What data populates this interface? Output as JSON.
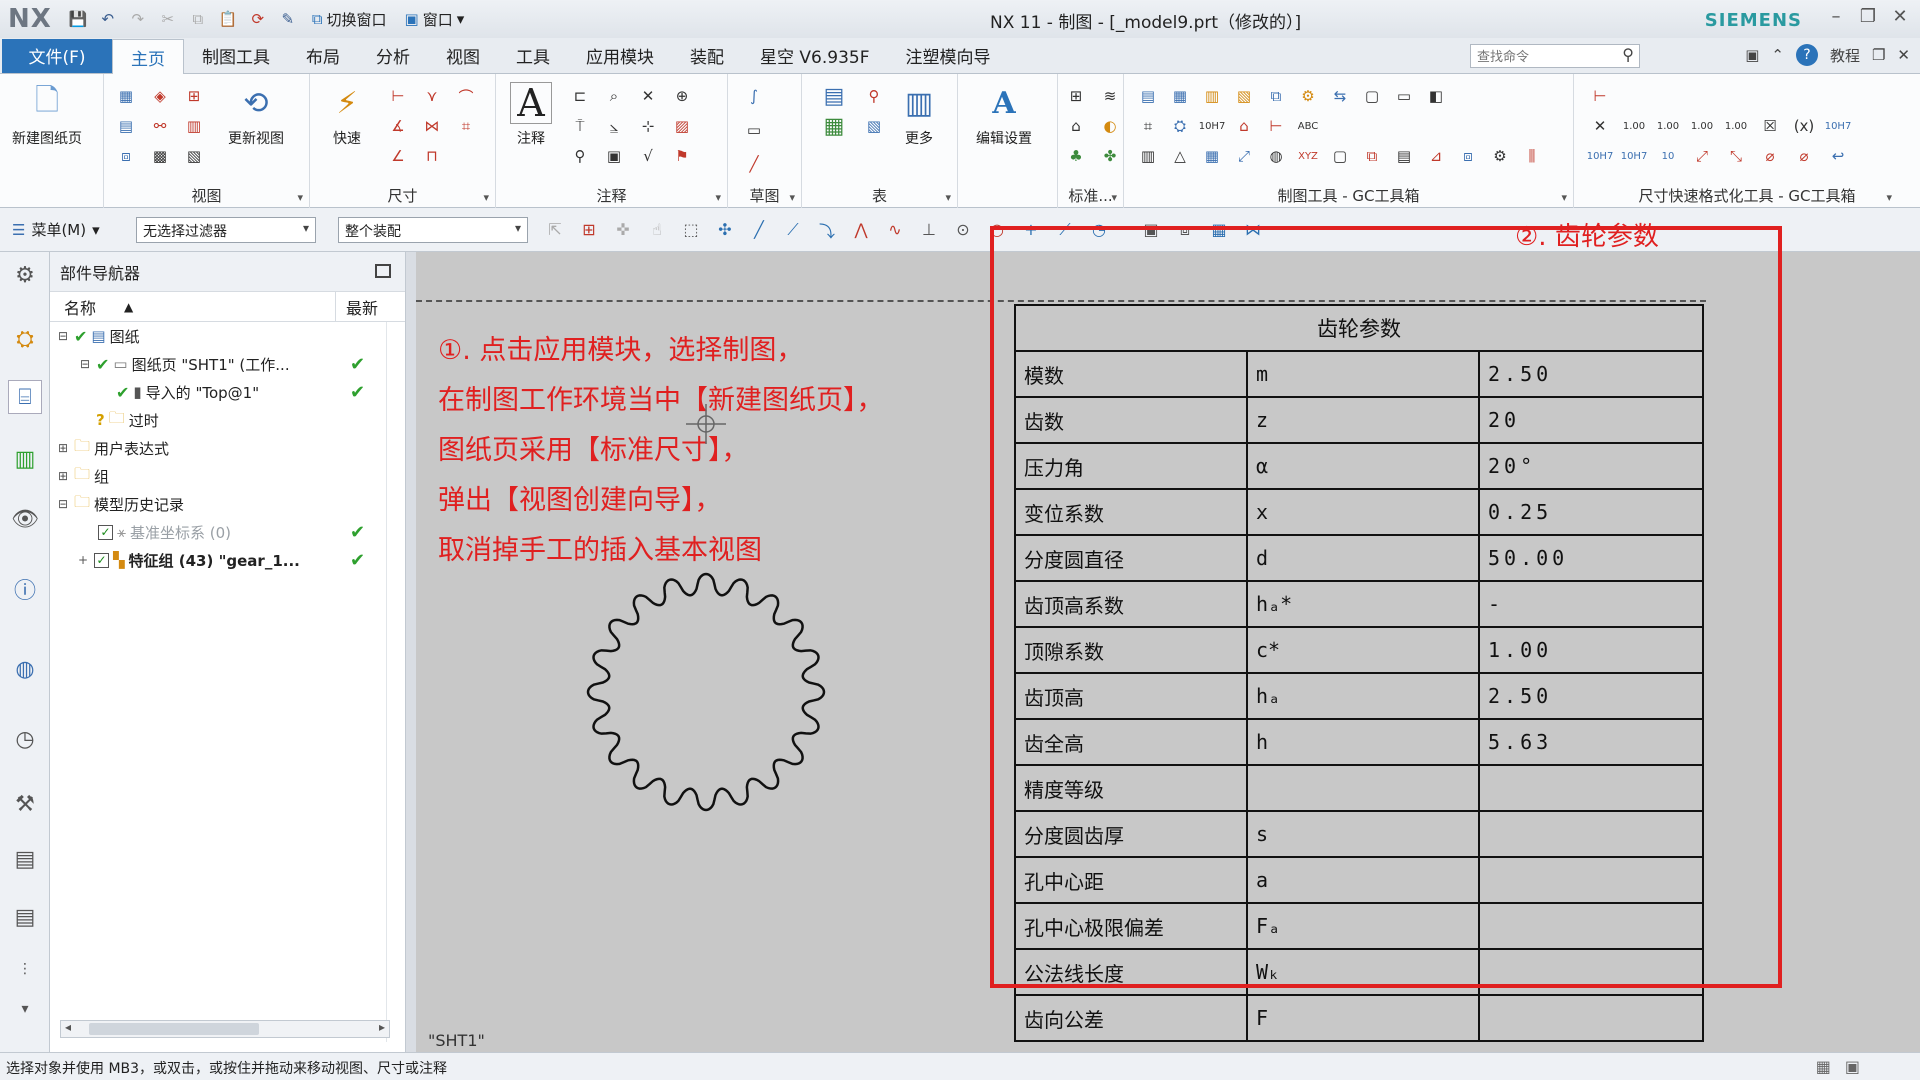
{
  "titlebar": {
    "app": "NX",
    "switch_window": "切换窗口",
    "window": "窗口",
    "title": "NX 11 - 制图 - [_model9.prt（修改的）]",
    "brand": "SIEMENS"
  },
  "menubar": {
    "file": "文件(F)",
    "tabs": [
      "主页",
      "制图工具",
      "布局",
      "分析",
      "视图",
      "工具",
      "应用模块",
      "装配",
      "星空 V6.935F",
      "注塑模向导"
    ],
    "search_placeholder": "查找命令",
    "tutorial": "教程"
  },
  "ribbon": {
    "new_sheet": "新建图纸页",
    "view_group": "视图",
    "update_view": "更新视图",
    "quick": "快速",
    "dim_group": "尺寸",
    "note": "注释",
    "annotation_group": "注释",
    "sketch_group": "草图",
    "table_group": "表",
    "more": "更多",
    "edit_settings": "编辑设置",
    "standard_group": "标准...",
    "gc_drafting": "制图工具 - GC工具箱",
    "gc_dim": "尺寸快速格式化工具 - GC工具箱"
  },
  "selbar": {
    "menu": "菜单(M)",
    "filter": "无选择过滤器",
    "scope": "整个装配"
  },
  "navigator": {
    "title": "部件导航器",
    "col_name": "名称",
    "col_latest": "最新",
    "rows": [
      {
        "label": "图纸"
      },
      {
        "label": "图纸页 \"SHT1\" (工作..."
      },
      {
        "label": "导入的 \"Top@1\""
      },
      {
        "label": "过时"
      },
      {
        "label": "用户表达式"
      },
      {
        "label": "组"
      },
      {
        "label": "模型历史记录"
      },
      {
        "label": "基准坐标系 (0)"
      },
      {
        "label": "特征组 (43) \"gear_1..."
      }
    ]
  },
  "canvas": {
    "annotation_lines": [
      "①. 点击应用模块，选择制图，",
      "在制图工作环境当中【新建图纸页】，",
      "图纸页采用【标准尺寸】，",
      "弹出【视图创建向导】，",
      "取消掉手工的插入基本视图"
    ],
    "gear_annotation": "②. 齿轮参数",
    "sheet_label": "\"SHT1\"",
    "gear_table": {
      "title": "齿轮参数",
      "rows": [
        {
          "name": "模数",
          "symbol": "m",
          "value": "2.50"
        },
        {
          "name": "齿数",
          "symbol": "z",
          "value": "20"
        },
        {
          "name": "压力角",
          "symbol": "α",
          "value": "20°"
        },
        {
          "name": "变位系数",
          "symbol": "x",
          "value": "0.25"
        },
        {
          "name": "分度圆直径",
          "symbol": "d",
          "value": "50.00"
        },
        {
          "name": "齿顶高系数",
          "symbol": "hₐ*",
          "value": "-"
        },
        {
          "name": "顶隙系数",
          "symbol": "c*",
          "value": "1.00"
        },
        {
          "name": "齿顶高",
          "symbol": "hₐ",
          "value": "2.50"
        },
        {
          "name": "齿全高",
          "symbol": "h",
          "value": "5.63"
        },
        {
          "name": "精度等级",
          "symbol": "",
          "value": ""
        },
        {
          "name": "分度圆齿厚",
          "symbol": "s",
          "value": ""
        },
        {
          "name": "孔中心距",
          "symbol": "a",
          "value": ""
        },
        {
          "name": "孔中心极限偏差",
          "symbol": "Fₐ",
          "value": ""
        },
        {
          "name": "公法线长度",
          "symbol": "Wₖ",
          "value": ""
        },
        {
          "name": "齿向公差",
          "symbol": "F",
          "value": ""
        }
      ]
    }
  },
  "status": {
    "text": "选择对象并使用 MB3，或双击，或按住并拖动来移动视图、尺寸或注释"
  },
  "colors": {
    "accent": "#2b73b9",
    "annotation_red": "#e02020",
    "check_green": "#2ea02e"
  }
}
